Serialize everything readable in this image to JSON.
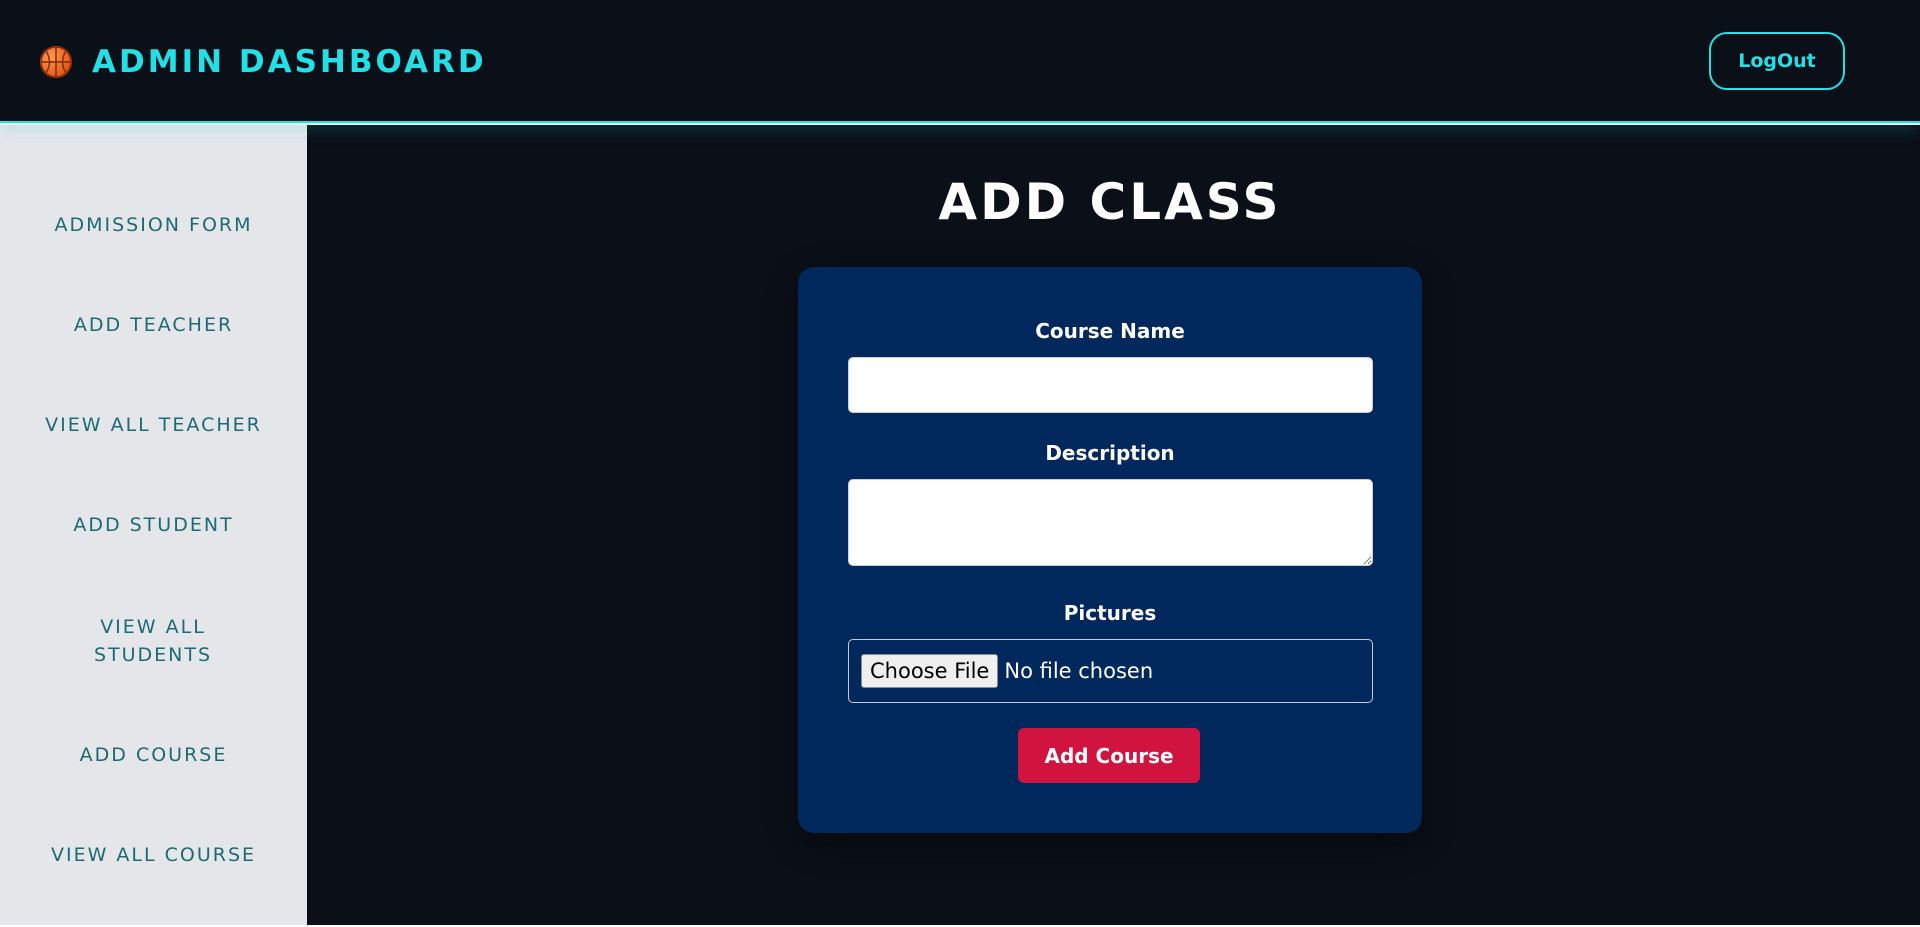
{
  "header": {
    "logo_icon": "basketball-icon",
    "title": "ADMIN DASHBOARD",
    "logout_label": "LogOut"
  },
  "sidebar": {
    "items": [
      {
        "label": "ADMISSION FORM"
      },
      {
        "label": "ADD TEACHER"
      },
      {
        "label": "VIEW ALL TEACHER"
      },
      {
        "label": "ADD STUDENT"
      },
      {
        "label": "VIEW ALL STUDENTS"
      },
      {
        "label": "ADD COURSE"
      },
      {
        "label": "VIEW ALL COURSE"
      }
    ]
  },
  "main": {
    "page_title": "ADD CLASS",
    "form": {
      "course_name_label": "Course Name",
      "course_name_value": "",
      "description_label": "Description",
      "description_value": "",
      "pictures_label": "Pictures",
      "choose_file_label": "Choose File",
      "file_status": "No file chosen",
      "submit_label": "Add Course"
    }
  },
  "colors": {
    "accent": "#22e0e6",
    "background": "#0b0f17",
    "sidebar_bg": "#e4e6ea",
    "sidebar_text": "#1d6b72",
    "form_bg": "#00285c",
    "submit_bg": "#d0143f"
  }
}
